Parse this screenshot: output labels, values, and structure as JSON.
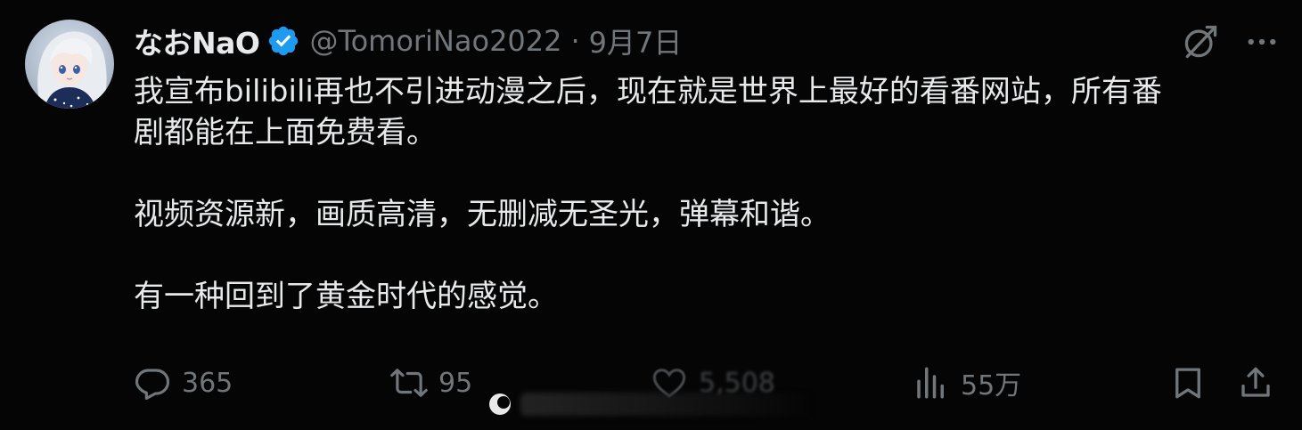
{
  "author": {
    "display_name": "なおNaO",
    "handle": "@TomoriNao2022",
    "separator": "·",
    "date": "9月7日",
    "verified": true
  },
  "tweet": {
    "paragraphs": [
      "我宣布bilibili再也不引进动漫之后，现在就是世界上最好的看番网站，所有番\n剧都能在上面免费看。",
      "视频资源新，画质高清，无删减无圣光，弹幕和谐。",
      "有一种回到了黄金时代的感觉。"
    ]
  },
  "actions": {
    "reply_count": "365",
    "retweet_count": "95",
    "like_count": "5,508",
    "views_count": "55万"
  },
  "icons": {
    "avatar": "anime-avatar",
    "verified": "verified-badge-icon",
    "grok": "grok-icon",
    "more": "more-icon",
    "reply": "reply-icon",
    "retweet": "retweet-icon",
    "like": "like-icon",
    "views": "views-icon",
    "bookmark": "bookmark-icon",
    "share": "share-icon"
  },
  "colors": {
    "background": "#000000",
    "text_primary": "#e7e9ea",
    "text_secondary": "#71767b",
    "verified_blue": "#1d9bf0"
  }
}
